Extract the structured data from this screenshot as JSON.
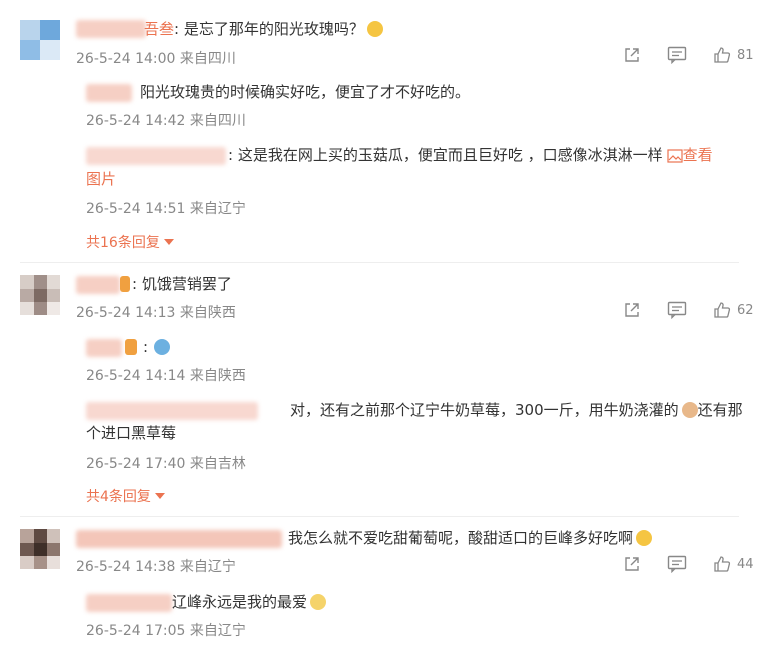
{
  "comments": [
    {
      "text": "是忘了那年的阳光玫瑰吗？",
      "name_tail": "吾叁",
      "time": "26-5-24 14:00",
      "location": "来自四川",
      "like_count": "81",
      "replies": [
        {
          "text": "阳光玫瑰贵的时候确实好吃，便宜了才不好吃的。",
          "time": "26-5-24 14:42",
          "location": "来自四川"
        },
        {
          "text_line1": ": 这是我在网上买的玉菇瓜，便宜而且巨好吃 ，口感像冰淇淋一样",
          "view_image_a": "查看",
          "view_image_b": "图片",
          "time": "26-5-24 14:51",
          "location": "来自辽宁"
        }
      ],
      "more_replies": "共16条回复"
    },
    {
      "text": ": 饥饿营销罢了",
      "time": "26-5-24 14:13",
      "location": "来自陕西",
      "like_count": "62",
      "replies": [
        {
          "text": ":",
          "time": "26-5-24 14:14",
          "location": "来自陕西"
        },
        {
          "text_line1": "对，还有之前那个辽宁牛奶草莓，300一斤，用牛奶浇灌的",
          "text_line1_tail": "还有那",
          "text_line2": "个进口黑草莓",
          "time": "26-5-24 17:40",
          "location": "来自吉林"
        }
      ],
      "more_replies": "共4条回复"
    },
    {
      "text": "我怎么就不爱吃甜葡萄呢，酸甜适口的巨峰多好吃啊",
      "time": "26-5-24 14:38",
      "location": "来自辽宁",
      "like_count": "44",
      "replies": [
        {
          "text": "辽峰永远是我的最爱",
          "time": "26-5-24 17:05",
          "location": "来自辽宁"
        }
      ]
    }
  ],
  "icons": {
    "share": "share-icon",
    "comment": "comment-icon",
    "like": "thumbs-up-icon",
    "image": "image-icon"
  },
  "colors": {
    "accent": "#eb7350",
    "meta": "#888888",
    "text": "#333333"
  }
}
